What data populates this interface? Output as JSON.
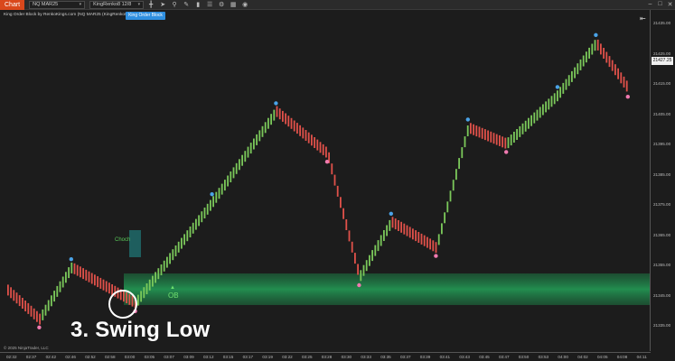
{
  "toolbar": {
    "tab_label": "Chart",
    "instrument": "NQ MAR25",
    "bar_type": "KingRenko8 12/8",
    "icons": [
      "crosshair-icon",
      "cursor-icon",
      "zoom-icon",
      "zoom-out-icon",
      "draw-icon",
      "bars-icon",
      "list-icon",
      "properties-icon",
      "camera-icon"
    ],
    "window_controls": [
      "–",
      "□",
      "✕"
    ]
  },
  "indicator": {
    "label": "King Order Block by RenkoKings.com (NQ MAR25 (KingRenko8 12/8))",
    "button": "King Order Block"
  },
  "annotations": {
    "swing_label": "3. Swing Low",
    "ob_label": "OB",
    "choch_label": "Choch"
  },
  "copyright": "© 2025 NinjaTrader, LLC",
  "current_price": "21427.25",
  "colors": {
    "up": "#7bc85a",
    "down": "#e0514a",
    "swing_high_dot": "#4aa3e8",
    "swing_low_dot": "#f07ab0",
    "ob_zone": "#1f8f4f",
    "background": "#1c1c1c"
  },
  "chart_data": {
    "type": "candlestick",
    "price_labels": [
      "21435.00",
      "21425.00",
      "21415.00",
      "21405.00",
      "21395.00",
      "21385.00",
      "21375.00",
      "21365.00",
      "21355.00",
      "21345.00",
      "21335.00"
    ],
    "time_labels": [
      "02:32",
      "02:37",
      "02:42",
      "02:46",
      "02:52",
      "02:58",
      "03:00",
      "03:05",
      "03:07",
      "03:09",
      "03:12",
      "03:15",
      "03:17",
      "03:19",
      "03:22",
      "03:25",
      "03:28",
      "03:30",
      "03:33",
      "03:35",
      "03:37",
      "03:39",
      "03:41",
      "03:43",
      "03:45",
      "03:47",
      "03:50",
      "03:53",
      "04:00",
      "04:02",
      "04:05",
      "04:08",
      "04:11"
    ],
    "swing_points": [
      [
        0,
        0.84
      ],
      [
        0.05,
        0.93
      ],
      [
        0.1,
        0.77
      ],
      [
        0.2,
        0.88
      ],
      [
        0.32,
        0.57
      ],
      [
        0.42,
        0.29
      ],
      [
        0.5,
        0.42
      ],
      [
        0.55,
        0.8
      ],
      [
        0.6,
        0.63
      ],
      [
        0.67,
        0.71
      ],
      [
        0.72,
        0.34
      ],
      [
        0.78,
        0.39
      ],
      [
        0.86,
        0.24
      ],
      [
        0.92,
        0.08
      ],
      [
        0.97,
        0.22
      ]
    ]
  }
}
